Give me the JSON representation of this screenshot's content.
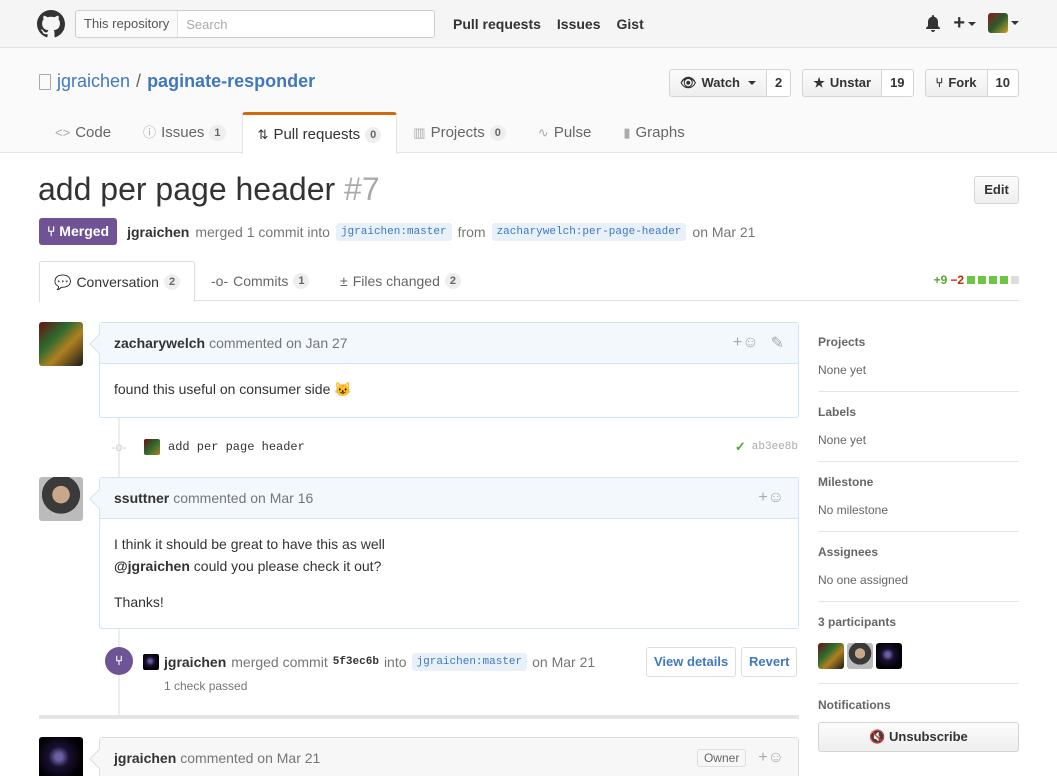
{
  "header": {
    "search_scope": "This repository",
    "search_placeholder": "Search",
    "nav": [
      "Pull requests",
      "Issues",
      "Gist"
    ]
  },
  "repo": {
    "owner": "jgraichen",
    "name": "paginate-responder",
    "watch_label": "Watch",
    "watch_count": "2",
    "star_label": "Unstar",
    "star_count": "19",
    "fork_label": "Fork",
    "fork_count": "10",
    "tabs": [
      {
        "label": "Code",
        "icon": "code-icon"
      },
      {
        "label": "Issues",
        "count": "1",
        "icon": "issue-icon"
      },
      {
        "label": "Pull requests",
        "count": "0",
        "icon": "pull-request-icon"
      },
      {
        "label": "Projects",
        "count": "0",
        "icon": "project-icon"
      },
      {
        "label": "Pulse",
        "icon": "pulse-icon"
      },
      {
        "label": "Graphs",
        "icon": "graph-icon"
      }
    ]
  },
  "pr": {
    "title": "add per page header",
    "number": "#7",
    "edit_label": "Edit",
    "state": "Merged",
    "author": "jgraichen",
    "merged_text": "merged 1 commit into",
    "base_ref": "jgraichen:master",
    "from_text": "from",
    "head_ref": "zacharywelch:per-page-header",
    "date_text": "on Mar 21",
    "tabs": [
      {
        "label": "Conversation",
        "count": "2"
      },
      {
        "label": "Commits",
        "count": "1"
      },
      {
        "label": "Files changed",
        "count": "2"
      }
    ],
    "additions": "+9",
    "deletions": "−2"
  },
  "timeline": {
    "comments": [
      {
        "author": "zacharywelch",
        "meta": "commented on Jan 27",
        "body": [
          "found this useful on consumer side 😺"
        ]
      },
      {
        "author": "ssuttner",
        "meta": "commented on Mar 16",
        "body": [
          "I think it should be great to have this as well",
          "@jgraichen",
          " could you please check it out?",
          "Thanks!"
        ]
      },
      {
        "author": "jgraichen",
        "meta": "commented on Mar 21",
        "badge": "Owner"
      }
    ],
    "commit": {
      "message": "add per page header",
      "sha": "ab3ee8b"
    },
    "merge": {
      "author": "jgraichen",
      "text": "merged commit",
      "sha": "5f3ec6b",
      "into": "into",
      "ref": "jgraichen:master",
      "date": "on Mar 21",
      "checks": "1 check passed",
      "view_details": "View details",
      "revert": "Revert"
    }
  },
  "sidebar": {
    "projects": {
      "label": "Projects",
      "value": "None yet"
    },
    "labels": {
      "label": "Labels",
      "value": "None yet"
    },
    "milestone": {
      "label": "Milestone",
      "value": "No milestone"
    },
    "assignees": {
      "label": "Assignees",
      "value": "No one assigned"
    },
    "participants": {
      "label": "3 participants"
    },
    "notifications": {
      "label": "Notifications",
      "button": "Unsubscribe"
    }
  },
  "colors": {
    "merged": "#6e5494",
    "link": "#4078c0",
    "tab_accent": "#d26911",
    "add": "#55a532",
    "del": "#bd2c00"
  }
}
